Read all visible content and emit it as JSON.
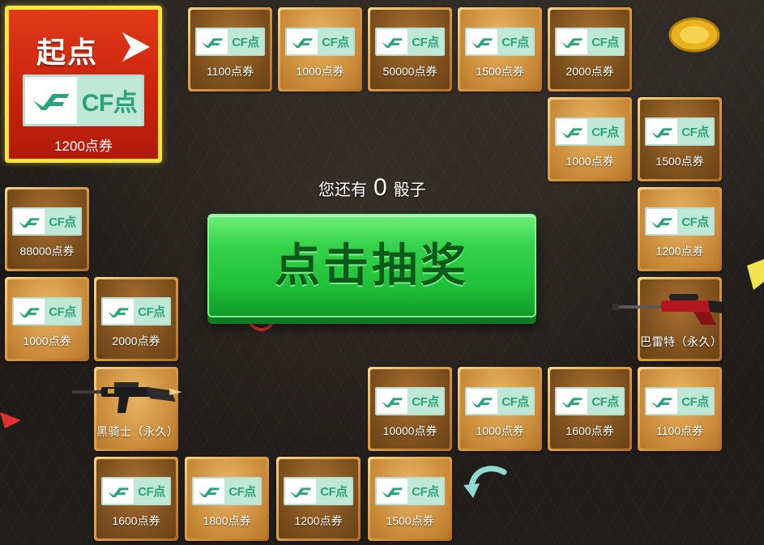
{
  "start": {
    "title": "起点",
    "card_text": "CF点",
    "label": "1200点券"
  },
  "dice": {
    "prefix": "您还有",
    "count": "0",
    "suffix": "骰子"
  },
  "draw_button": {
    "label": "点击抽奖"
  },
  "card_text": "CF点",
  "tiles": [
    {
      "label": "1100点券"
    },
    {
      "label": "1000点券"
    },
    {
      "label": "50000点券"
    },
    {
      "label": "1500点券"
    },
    {
      "label": "2000点券"
    },
    {
      "label": "1000点券"
    },
    {
      "label": "1500点券"
    },
    {
      "label": "1200点券"
    },
    {
      "label": "巴雷特（永久）"
    },
    {
      "label": "1100点券"
    },
    {
      "label": "1600点券"
    },
    {
      "label": "1000点券"
    },
    {
      "label": "10000点券"
    },
    {
      "label": "1500点券"
    },
    {
      "label": "1200点券"
    },
    {
      "label": "1800点券"
    },
    {
      "label": "1600点券"
    },
    {
      "label": "黑骑士（永久）"
    },
    {
      "label": "2000点券"
    },
    {
      "label": "1000点券"
    },
    {
      "label": "88000点券"
    }
  ],
  "colors": {
    "accent_green": "#20c03a",
    "start_red": "#c9230e",
    "start_border": "#ffe53a",
    "tile_gold": "#dfa24a"
  }
}
